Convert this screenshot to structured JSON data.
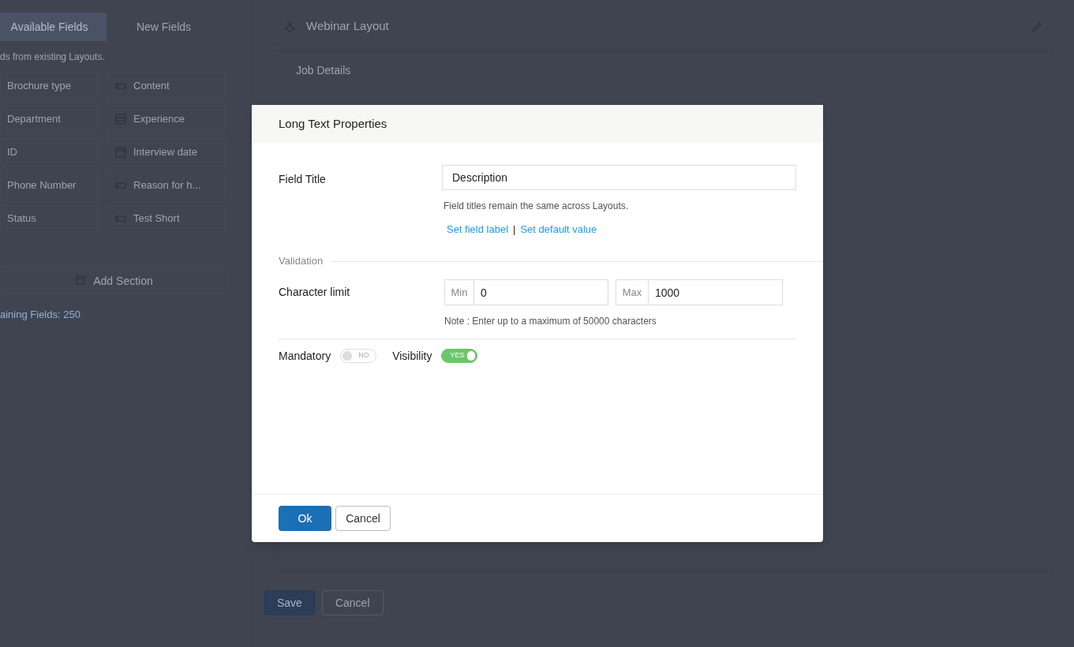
{
  "sidebar": {
    "tabs": [
      {
        "label": "Available Fields",
        "selected": true
      },
      {
        "label": "New Fields",
        "selected": false
      }
    ],
    "hint": "ds from existing Layouts.",
    "fields": [
      {
        "label": "Brochure type",
        "kind": "plain"
      },
      {
        "label": "Content",
        "kind": "text"
      },
      {
        "label": "Department",
        "kind": "plain"
      },
      {
        "label": "Experience",
        "kind": "form"
      },
      {
        "label": "ID",
        "kind": "plain"
      },
      {
        "label": "Interview date",
        "kind": "date"
      },
      {
        "label": "Phone Number",
        "kind": "plain"
      },
      {
        "label": "Reason for h...",
        "kind": "text"
      },
      {
        "label": "Status",
        "kind": "plain"
      },
      {
        "label": "Test Short",
        "kind": "text"
      }
    ],
    "add_section": "Add Section",
    "remaining": "aining Fields: 250"
  },
  "layout": {
    "title": "Webinar Layout",
    "section": "Job Details",
    "buttons": [
      {
        "label": "Save",
        "kind": "primary"
      },
      {
        "label": "Cancel",
        "kind": "secondary"
      }
    ]
  },
  "dialog": {
    "title": "Long Text Properties",
    "field_title": {
      "label": "Field Title",
      "value": "Description",
      "hint": "Field titles remain the same across Layouts."
    },
    "links": [
      "Set field label",
      "Set default value"
    ],
    "link_separator": "|",
    "validation": "Validation",
    "character_limit": {
      "label": "Character limit",
      "min_label": "Min",
      "min_value": "0",
      "max_label": "Max",
      "max_value": "1000",
      "note": "Note : Enter up to a maximum of 50000 characters"
    },
    "toggles": [
      {
        "label": "Mandatory",
        "on": false,
        "text": "NO"
      },
      {
        "label": "Visibility",
        "on": true,
        "text": "YES"
      }
    ],
    "buttons": [
      {
        "label": "Ok",
        "kind": "primary"
      },
      {
        "label": "Cancel",
        "kind": "secondary"
      }
    ]
  }
}
